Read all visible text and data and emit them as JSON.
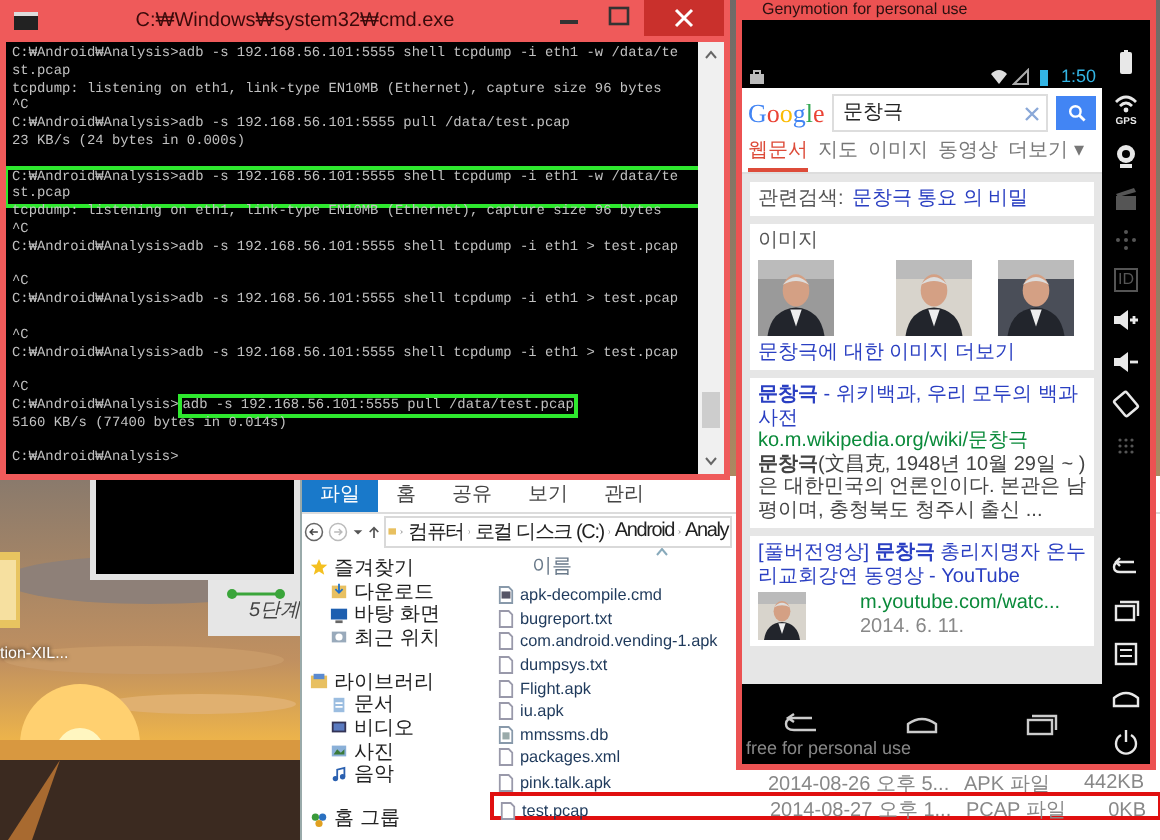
{
  "desktop": {
    "icon_label": "tion-XIL...",
    "panel_label": "5단계"
  },
  "cmd": {
    "title": "C:₩Windows₩system32₩cmd.exe",
    "lines": [
      {
        "kind": "prompt",
        "prompt": "C:₩Android₩Analysis>",
        "text": "adb -s 192.168.56.101:5555 shell tcpdump -i eth1 -w /data/te",
        "boxed": false,
        "command_boxed": false
      },
      {
        "kind": "output",
        "text": "st.pcap",
        "boxed": false
      },
      {
        "kind": "output",
        "text": "tcpdump: listening on eth1, link-type EN10MB (Ethernet), capture size 96 bytes",
        "boxed": false
      },
      {
        "kind": "output",
        "text": "^C",
        "boxed": false
      },
      {
        "kind": "prompt",
        "prompt": "C:₩Android₩Analysis>",
        "text": "adb -s 192.168.56.101:5555 pull /data/test.pcap",
        "boxed": false,
        "command_boxed": false
      },
      {
        "kind": "output",
        "text": "23 KB/s (24 bytes in 0.000s)",
        "boxed": false
      },
      {
        "kind": "blank",
        "boxed": false
      },
      {
        "kind": "prompt",
        "prompt": "C:₩Android₩Analysis>",
        "text": "adb -s 192.168.56.101:5555 shell tcpdump -i eth1 -w /data/te",
        "boxed": true,
        "command_boxed": false
      },
      {
        "kind": "output",
        "text": "st.pcap",
        "boxed": true
      },
      {
        "kind": "output",
        "text": "tcpdump: listening on eth1, link-type EN10MB (Ethernet), capture size 96 bytes",
        "boxed": false
      },
      {
        "kind": "output",
        "text": "^C",
        "boxed": false
      },
      {
        "kind": "prompt",
        "prompt": "C:₩Android₩Analysis>",
        "text": "adb -s 192.168.56.101:5555 shell tcpdump -i eth1 > test.pcap",
        "boxed": false,
        "command_boxed": false
      },
      {
        "kind": "blank",
        "boxed": false
      },
      {
        "kind": "output",
        "text": "^C",
        "boxed": false
      },
      {
        "kind": "prompt",
        "prompt": "C:₩Android₩Analysis>",
        "text": "adb -s 192.168.56.101:5555 shell tcpdump -i eth1 > test.pcap",
        "boxed": false,
        "command_boxed": false
      },
      {
        "kind": "blank",
        "boxed": false
      },
      {
        "kind": "output",
        "text": "^C",
        "boxed": false
      },
      {
        "kind": "prompt",
        "prompt": "C:₩Android₩Analysis>",
        "text": "adb -s 192.168.56.101:5555 shell tcpdump -i eth1 > test.pcap",
        "boxed": false,
        "command_boxed": false
      },
      {
        "kind": "blank",
        "boxed": false
      },
      {
        "kind": "output",
        "text": "^C",
        "boxed": false
      },
      {
        "kind": "prompt",
        "prompt": "C:₩Android₩Analysis>",
        "text": "adb -s 192.168.56.101:5555 pull /data/test.pcap",
        "boxed": false,
        "command_boxed": true
      },
      {
        "kind": "output",
        "text": "5160 KB/s (77400 bytes in 0.014s)",
        "boxed": false
      },
      {
        "kind": "blank",
        "boxed": false
      },
      {
        "kind": "prompt",
        "prompt": "C:₩Android₩Analysis>",
        "boxed": false
      }
    ]
  },
  "explorer": {
    "ribbon_tabs": [
      {
        "label": "파일",
        "selected": true
      },
      {
        "label": "홈",
        "selected": false
      },
      {
        "label": "공유",
        "selected": false
      },
      {
        "label": "보기",
        "selected": false
      },
      {
        "label": "관리",
        "selected": false
      }
    ],
    "breadcrumbs": [
      "컴퓨터",
      "로컬 디스크 (C:)",
      "Android",
      "Analy"
    ],
    "nav": [
      {
        "label": "즐겨찾기",
        "kind": "header"
      },
      {
        "label": "다운로드",
        "kind": "item"
      },
      {
        "label": "바탕 화면",
        "kind": "item"
      },
      {
        "label": "최근 위치",
        "kind": "item"
      },
      {
        "label": "라이브러리",
        "kind": "header"
      },
      {
        "label": "문서",
        "kind": "item"
      },
      {
        "label": "비디오",
        "kind": "item"
      },
      {
        "label": "사진",
        "kind": "item"
      },
      {
        "label": "음악",
        "kind": "item"
      },
      {
        "label": "홈 그룹",
        "kind": "header"
      }
    ],
    "name_column": "이름",
    "files": [
      {
        "name": "apk-decompile.cmd",
        "kind": "script",
        "boxed": false
      },
      {
        "name": "bugreport.txt",
        "kind": "document",
        "boxed": false
      },
      {
        "name": "com.android.vending-1.apk",
        "kind": "document",
        "boxed": false
      },
      {
        "name": "dumpsys.txt",
        "kind": "document",
        "boxed": false
      },
      {
        "name": "Flight.apk",
        "kind": "document",
        "boxed": false
      },
      {
        "name": "iu.apk",
        "kind": "document",
        "boxed": false
      },
      {
        "name": "mmssms.db",
        "kind": "database",
        "boxed": false
      },
      {
        "name": "packages.xml",
        "kind": "document",
        "boxed": false
      },
      {
        "name": "pink.talk.apk",
        "kind": "document",
        "date": "2014-08-26 오후 5...",
        "type": "APK 파일",
        "size": "442KB",
        "boxed": false
      },
      {
        "name": "test.pcap",
        "kind": "document",
        "date": "2014-08-27 오후 1...",
        "type": "PCAP 파일",
        "size": "0KB",
        "boxed": true
      }
    ]
  },
  "emulator": {
    "title": "Genymotion for personal use",
    "time": "1:50",
    "logo": "Google",
    "query": "문창극",
    "tabs": [
      {
        "label": "웹문서",
        "selected": true
      },
      {
        "label": "지도",
        "selected": false
      },
      {
        "label": "이미지",
        "selected": false
      },
      {
        "label": "동영상",
        "selected": false
      },
      {
        "label": "더보기 ▾",
        "selected": false
      }
    ],
    "related_label": "관련검색:",
    "related_link": "문창극 통요 의 비밀",
    "images_heading": "이미지",
    "images_more": "문창극에 대한 이미지 더보기",
    "results": [
      {
        "title": "**문창극** - 위키백과, 우리 모두의 백과사전",
        "url": "ko.m.wikipedia.org/wiki/문창극",
        "snippet": "**문창극**(文昌克, 1948년 10월 29일 ~ )은 대한민국의 언론인이다. 본관은 남평이며, 충청북도 청주시 출신 ..."
      },
      {
        "title": "[풀버전영상] **문창극** 총리지명자 온누리교회강연 동영상 - YouTube",
        "url": "m.youtube.com/watc...",
        "date": "2014. 6. 11."
      }
    ],
    "watermark": "free for personal use",
    "toolbar_top": [
      {
        "kind": "battery",
        "disabled": false
      },
      {
        "kind": "gps",
        "label": "GPS",
        "disabled": false
      },
      {
        "kind": "camera",
        "disabled": false
      },
      {
        "kind": "clapper",
        "disabled": true
      },
      {
        "kind": "dpad",
        "disabled": true
      },
      {
        "kind": "id",
        "label": "ID",
        "disabled": true
      },
      {
        "kind": "volume_up",
        "disabled": false
      },
      {
        "kind": "volume_down",
        "disabled": false
      },
      {
        "kind": "rotate",
        "disabled": false
      },
      {
        "kind": "dots",
        "disabled": true
      }
    ],
    "toolbar_bottom": [
      {
        "kind": "back",
        "disabled": false
      },
      {
        "kind": "recent",
        "disabled": false
      },
      {
        "kind": "menu",
        "disabled": false
      },
      {
        "kind": "home",
        "disabled": false
      },
      {
        "kind": "power",
        "disabled": false
      }
    ]
  }
}
